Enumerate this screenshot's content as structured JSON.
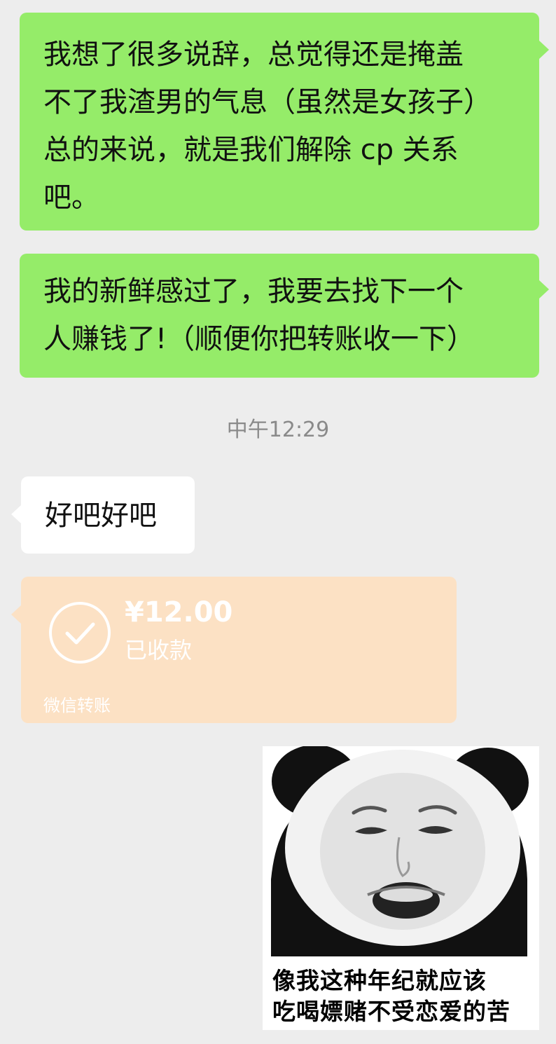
{
  "messages": {
    "msg1": {
      "lines": [
        "我想了很多说辞，总觉得还是掩盖",
        "不了我渣男的气息（虽然是女孩子）",
        "总的来说，就是我们解除 cp 关系",
        "吧。"
      ]
    },
    "msg2": {
      "lines": [
        "我的新鲜感过了，我要去找下一个",
        "人赚钱了!（顺便你把转账收一下）"
      ]
    },
    "timestamp": "中午12:29",
    "msg3": {
      "text": "好吧好吧"
    },
    "transfer": {
      "amount": "¥12.00",
      "status": "已收款",
      "footer": "微信转账",
      "icon": "check-circle-icon"
    },
    "sticker": {
      "caption_lines": [
        "像我这种年纪就应该",
        "吃喝嫖赌不受恋爱的苦"
      ]
    }
  },
  "colors": {
    "background": "#ededed",
    "sent_bubble": "#95ec69",
    "received_bubble": "#ffffff",
    "transfer_card": "#fce1c4",
    "timestamp_text": "#8a8a8a"
  }
}
